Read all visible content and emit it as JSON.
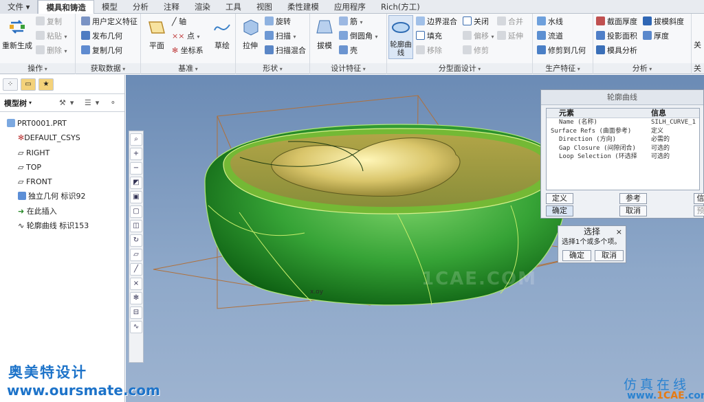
{
  "tabs": [
    "文件",
    "模具和铸造",
    "模型",
    "分析",
    "注释",
    "渲染",
    "工具",
    "视图",
    "柔性建模",
    "应用程序",
    "Rich(方工)"
  ],
  "ribbon": {
    "op": {
      "title": "操作",
      "regen": "重新生成",
      "copy": "复制",
      "paste": "粘贴",
      "delete": "删除"
    },
    "data": {
      "title": "获取数据",
      "udf": "用户定义特征",
      "publish": "发布几何",
      "copygeom": "复制几何"
    },
    "datum": {
      "title": "基准",
      "plane": "平面",
      "axis": "轴",
      "point": "点",
      "csys": "坐标系",
      "sketch": "草绘"
    },
    "shape": {
      "title": "形状",
      "extrude": "拉伸",
      "revolve": "旋转",
      "sweep": "扫描",
      "sweepblend": "扫描混合"
    },
    "design": {
      "title": "设计特征",
      "draft": "拔模",
      "rib": "筋",
      "round": "倒圆角",
      "shell": "壳"
    },
    "parting": {
      "title": "分型面设计",
      "silhouette": "轮廓曲线",
      "boundary": "边界混合",
      "close": "关闭",
      "merge": "合并",
      "fill": "填充",
      "offset": "偏移",
      "extend": "延伸",
      "move": "移除",
      "trim": "修剪"
    },
    "prod": {
      "title": "生产特征",
      "waterline": "水线",
      "runner": "流道",
      "trimgeom": "修剪到几何"
    },
    "analysis": {
      "title": "分析",
      "thickness": "截面厚度",
      "draftcheck": "拔模斜度",
      "projarea": "投影面积",
      "thick2": "厚度",
      "moldanalysis": "模具分析"
    },
    "more": {
      "title": "关",
      "label": "关"
    }
  },
  "tree": {
    "header": "模型树",
    "items": [
      "PRT0001.PRT",
      "DEFAULT_CSYS",
      "RIGHT",
      "TOP",
      "FRONT",
      "独立几何 标识92",
      "在此插入",
      "轮廓曲线 标识153"
    ]
  },
  "dialog": {
    "title": "轮廓曲线",
    "col1": "元素",
    "col2": "信息",
    "rows": [
      {
        "e": "Name (名称)",
        "i": "SILH_CURVE_1"
      },
      {
        "e": "Surface Refs (曲面参考)",
        "i": "定义"
      },
      {
        "e": "Direction (方向)",
        "i": "必需的"
      },
      {
        "e": "Gap Closure (间隙闭合)",
        "i": "可选的"
      },
      {
        "e": "Loop Selection (环选择",
        "i": "可选的"
      }
    ],
    "define": "定义",
    "refer": "参考",
    "info": "信",
    "ok": "确定",
    "cancel": "取消",
    "preview": "预"
  },
  "select": {
    "title": "选择",
    "close": "×",
    "prompt": "选择1个或多个项。",
    "ok": "确定",
    "cancel": "取消"
  },
  "watermark": {
    "cn": "奥美特设计",
    "url": "www.oursmate.com",
    "site": "仿真在线",
    "site_url_a": "www.",
    "site_url_b": "1CAE",
    "site_url_c": ".com",
    "center": "1CAE.COM"
  },
  "model_label": "x.oy"
}
